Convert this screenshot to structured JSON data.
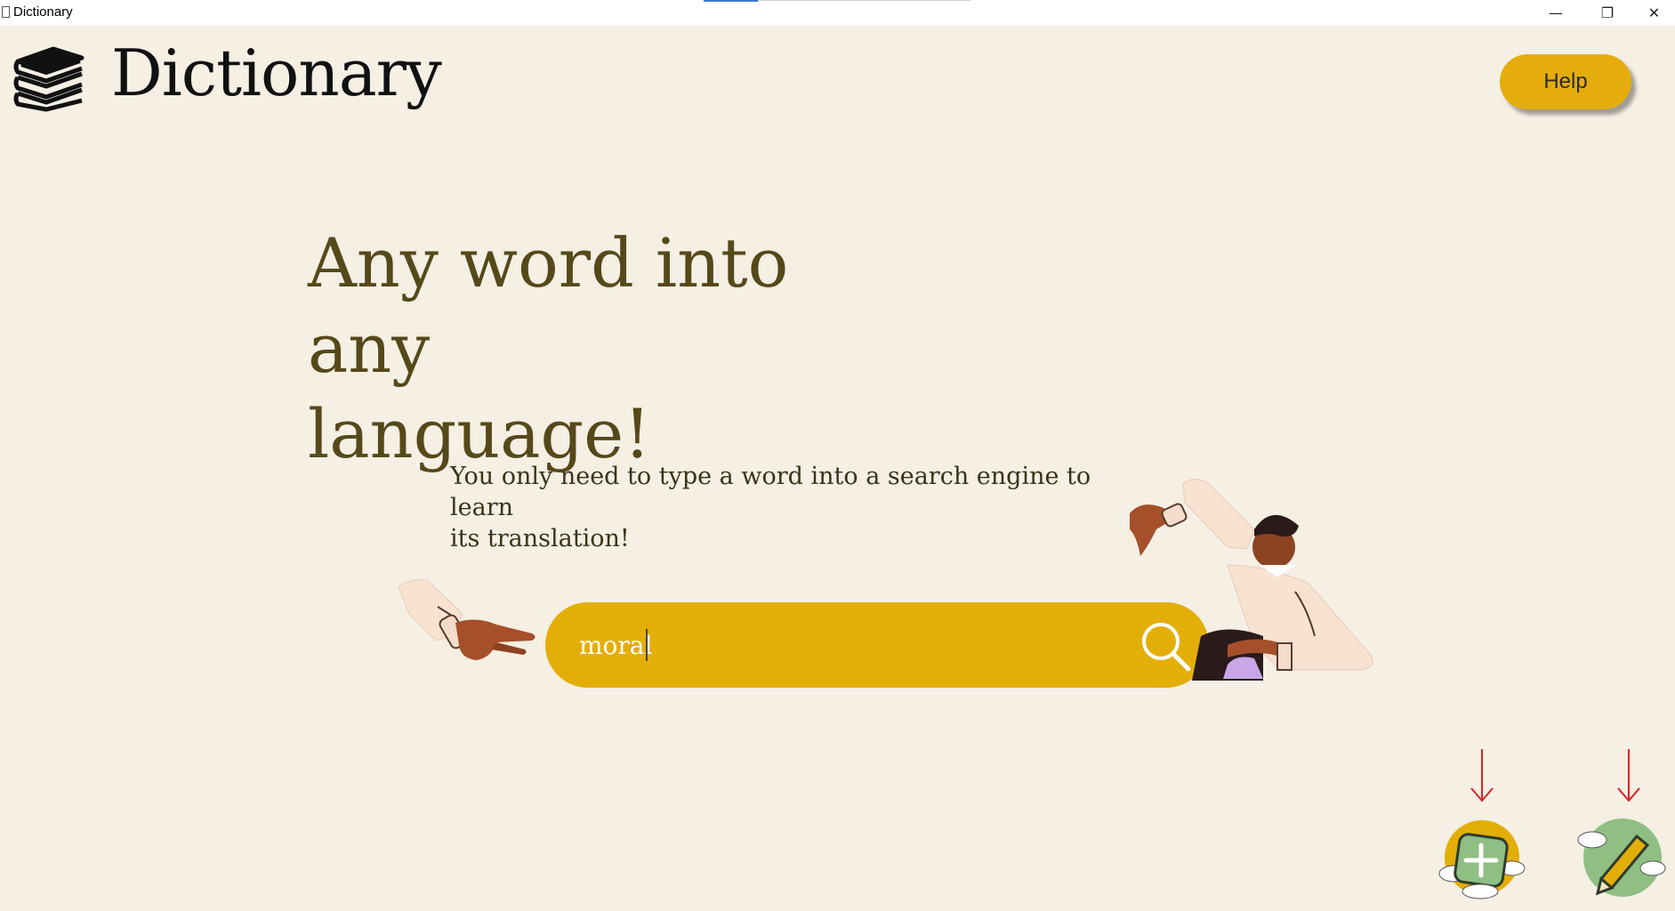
{
  "window": {
    "title": "Dictionary",
    "minimize_glyph": "—",
    "restore_glyph": "❐",
    "close_glyph": "✕"
  },
  "header": {
    "app_name": "Dictionary",
    "help_label": "Help",
    "logo_icon": "books-stack-icon"
  },
  "hero": {
    "headline_line1": "Any word into any",
    "headline_line2": "language!",
    "subtext_line1": "You only need to type a word into a search engine to learn",
    "subtext_line2": "its translation!"
  },
  "search": {
    "value": "moral",
    "placeholder": "",
    "icon": "search-icon"
  },
  "actions": {
    "add_icon": "add-word-icon",
    "edit_icon": "edit-word-icon",
    "arrow_color": "#d8242b"
  },
  "colors": {
    "background": "#f5efe4",
    "accent": "#e4ae09",
    "headline": "#55491a"
  }
}
